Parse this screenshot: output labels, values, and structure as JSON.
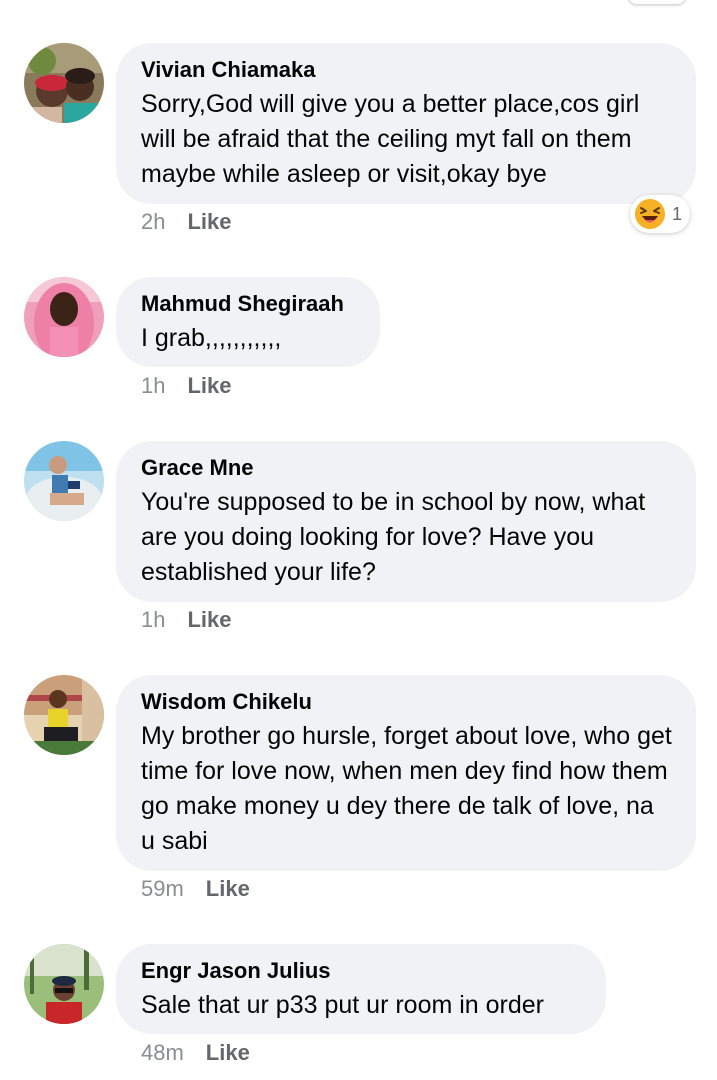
{
  "comments": [
    {
      "author": "Vivian Chiamaka",
      "text": "Sorry,God will give you a better place,cos girl will be afraid that the ceiling myt fall on them maybe while asleep or visit,okay bye",
      "time": "2h",
      "like_label": "Like",
      "reaction": {
        "icon": "laughing-emoji-icon",
        "count": "1"
      }
    },
    {
      "author": "Mahmud Shegiraah",
      "text": "I grab,,,,,,,,,,,",
      "time": "1h",
      "like_label": "Like"
    },
    {
      "author": "Grace Mne",
      "text": "You're supposed to be in school by now, what are you doing looking for love? Have you established your life?",
      "time": "1h",
      "like_label": "Like"
    },
    {
      "author": "Wisdom Chikelu",
      "text": "My brother go hursle,  forget about love, who get time for love now,  when men dey find how them go make money u dey there de talk of love,  na u sabi",
      "time": "59m",
      "like_label": "Like"
    },
    {
      "author": "Engr Jason Julius",
      "text": "Sale that ur p33 put ur room in order",
      "time": "48m",
      "like_label": "Like"
    }
  ]
}
